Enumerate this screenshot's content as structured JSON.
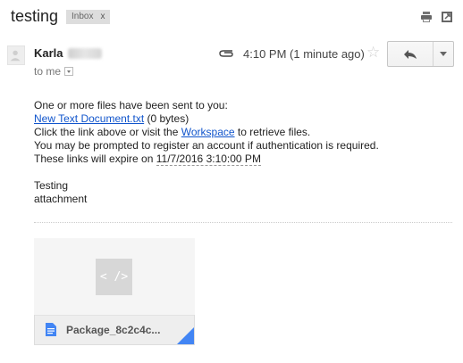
{
  "header": {
    "subject": "testing",
    "label": "Inbox",
    "label_close": "x",
    "icons": [
      "print-icon",
      "new-window-icon"
    ]
  },
  "message": {
    "sender_visible": "Karla",
    "recipient": "to me",
    "time": "4:10 PM (1 minute ago)",
    "icons": [
      "paperclip-icon",
      "star-icon",
      "reply-icon",
      "more-icon"
    ],
    "body": {
      "line1": "One or more files have been sent to you:",
      "file_link": "New Text Document.txt",
      "file_size": " (0 bytes)",
      "line3_pre": "Click the link above or visit the ",
      "workspace_link": "Workspace",
      "line3_post": " to retrieve files.",
      "line4": "You may be prompted to register an account if authentication is required.",
      "line5_pre": "These links will expire on ",
      "expiry": "11/7/2016 3:10:00 PM",
      "sign1": "Testing",
      "sign2": "attachment"
    }
  },
  "attachment": {
    "thumb_glyph": "< />",
    "name": "Package_8c2c4c...",
    "accent": "#4285f4"
  }
}
